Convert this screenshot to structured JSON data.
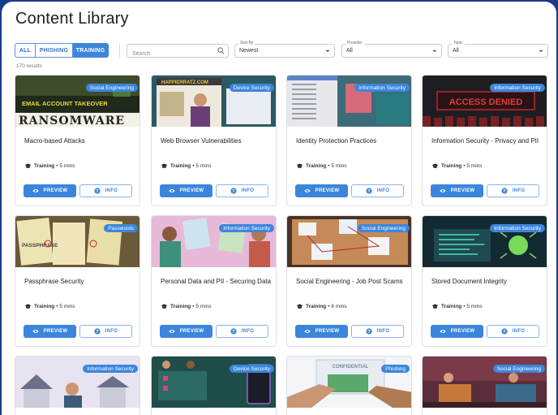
{
  "page": {
    "title": "Content Library"
  },
  "filters": {
    "type_tabs": [
      {
        "label": "ALL",
        "active": false
      },
      {
        "label": "PHISHING",
        "active": false
      },
      {
        "label": "TRAINING",
        "active": true
      }
    ],
    "search": {
      "placeholder": "Search",
      "value": "",
      "icon": "search-icon"
    },
    "sort_by": {
      "label": "Sort By",
      "value": "Newest"
    },
    "provider": {
      "label": "Provider",
      "value": "All"
    },
    "topic": {
      "label": "Topic",
      "value": "All"
    }
  },
  "results_count": "170 results",
  "colors": {
    "accent": "#3b86dc",
    "frame": "#1a3a8a"
  },
  "actions": {
    "preview_label": "PREVIEW",
    "info_label": "INFO"
  },
  "cards": [
    {
      "title": "Macro-based Attacks",
      "badge": "Social Engineering",
      "kind": "Training",
      "duration": "• 5 mins"
    },
    {
      "title": "Web Browser Vulnerabilities",
      "badge": "Device Security",
      "kind": "Training",
      "duration": "• 5 mins"
    },
    {
      "title": "Identity Protection Practices",
      "badge": "Information Security",
      "kind": "Training",
      "duration": "• 5 mins"
    },
    {
      "title": "Information Security - Privacy and PII",
      "badge": "Information Security",
      "kind": "Training",
      "duration": "• 5 mins"
    },
    {
      "title": "Passphrase Security",
      "badge": "Passwords",
      "kind": "Training",
      "duration": "• 5 mins"
    },
    {
      "title": "Personal Data and PII - Securing Data",
      "badge": "Information Security",
      "kind": "Training",
      "duration": "• 5 mins"
    },
    {
      "title": "Social Engineering - Job Post Scams",
      "badge": "Social Engineering",
      "kind": "Training",
      "duration": "• 6 mins"
    },
    {
      "title": "Stored Document Integrity",
      "badge": "Information Security",
      "kind": "Training",
      "duration": "• 5 mins"
    },
    {
      "title": "",
      "badge": "Information Security",
      "kind": "",
      "duration": ""
    },
    {
      "title": "",
      "badge": "Device Security",
      "kind": "",
      "duration": ""
    },
    {
      "title": "",
      "badge": "Phishing",
      "kind": "",
      "duration": ""
    },
    {
      "title": "",
      "badge": "Social Engineering",
      "kind": "",
      "duration": ""
    }
  ],
  "thumb_text": {
    "email_takeover": "EMAIL ACCOUNT TAKEOVER",
    "ransomware": "RANSOMWARE",
    "happierratz": "HAPPIERRATZ.COM",
    "access_denied": "ACCESS DENIED",
    "passphrase": "PASSPHRASE",
    "confidential": "CONFIDENTIAL"
  }
}
